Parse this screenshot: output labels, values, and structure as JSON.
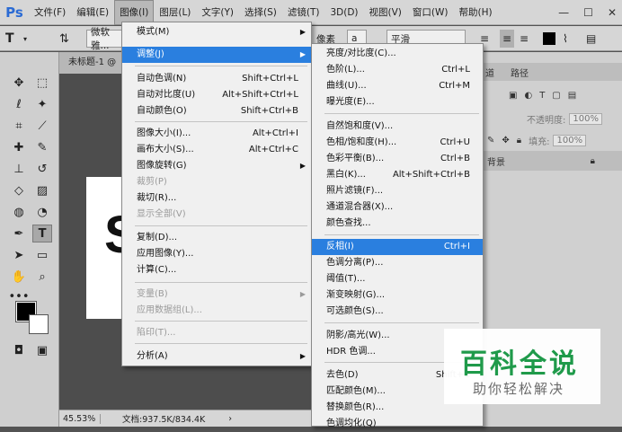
{
  "app": {
    "logo": "Ps",
    "menubar": [
      "文件(F)",
      "编辑(E)",
      "图像(I)",
      "图层(L)",
      "文字(Y)",
      "选择(S)",
      "滤镜(T)",
      "3D(D)",
      "视图(V)",
      "窗口(W)",
      "帮助(H)"
    ],
    "active_menu_index": 2,
    "window_controls": [
      "—",
      "☐",
      "✕"
    ]
  },
  "options_bar": {
    "font_name": "微软雅...",
    "font_style": "像素",
    "aa_label": "a",
    "aa_mode": "平滑"
  },
  "document": {
    "tab_title": "未标题-1 @",
    "zoom": "45.53%",
    "doc_info": "文档:937.5K/834.4K",
    "canvas_letter": "S"
  },
  "panels": {
    "tabs": [
      "道",
      "路径"
    ],
    "opacity_label": "不透明度:",
    "opacity_value": "100%",
    "fill_label": "填充:",
    "fill_value": "100%",
    "layer_name": "背景"
  },
  "image_menu": {
    "items": [
      {
        "label": "模式(M)",
        "shortcut": "",
        "arrow": true,
        "disabled": false
      },
      {
        "label": "调整(J)",
        "shortcut": "",
        "arrow": true,
        "disabled": false,
        "highlighted": true
      },
      {
        "label": "自动色调(N)",
        "shortcut": "Shift+Ctrl+L"
      },
      {
        "label": "自动对比度(U)",
        "shortcut": "Alt+Shift+Ctrl+L"
      },
      {
        "label": "自动颜色(O)",
        "shortcut": "Shift+Ctrl+B"
      },
      {
        "label": "图像大小(I)...",
        "shortcut": "Alt+Ctrl+I"
      },
      {
        "label": "画布大小(S)...",
        "shortcut": "Alt+Ctrl+C"
      },
      {
        "label": "图像旋转(G)",
        "shortcut": "",
        "arrow": true
      },
      {
        "label": "裁剪(P)",
        "shortcut": "",
        "disabled": true
      },
      {
        "label": "裁切(R)...",
        "shortcut": ""
      },
      {
        "label": "显示全部(V)",
        "shortcut": "",
        "disabled": true
      },
      {
        "label": "复制(D)...",
        "shortcut": ""
      },
      {
        "label": "应用图像(Y)...",
        "shortcut": ""
      },
      {
        "label": "计算(C)...",
        "shortcut": ""
      },
      {
        "label": "变量(B)",
        "shortcut": "",
        "arrow": true,
        "disabled": true
      },
      {
        "label": "应用数据组(L)...",
        "shortcut": "",
        "disabled": true
      },
      {
        "label": "陷印(T)...",
        "shortcut": "",
        "disabled": true
      },
      {
        "label": "分析(A)",
        "shortcut": "",
        "arrow": true
      }
    ]
  },
  "adjust_menu": {
    "items": [
      {
        "label": "亮度/对比度(C)...",
        "shortcut": ""
      },
      {
        "label": "色阶(L)...",
        "shortcut": "Ctrl+L"
      },
      {
        "label": "曲线(U)...",
        "shortcut": "Ctrl+M"
      },
      {
        "label": "曝光度(E)...",
        "shortcut": ""
      },
      {
        "label": "自然饱和度(V)...",
        "shortcut": ""
      },
      {
        "label": "色相/饱和度(H)...",
        "shortcut": "Ctrl+U"
      },
      {
        "label": "色彩平衡(B)...",
        "shortcut": "Ctrl+B"
      },
      {
        "label": "黑白(K)...",
        "shortcut": "Alt+Shift+Ctrl+B"
      },
      {
        "label": "照片滤镜(F)...",
        "shortcut": ""
      },
      {
        "label": "通道混合器(X)...",
        "shortcut": ""
      },
      {
        "label": "颜色查找...",
        "shortcut": ""
      },
      {
        "label": "反相(I)",
        "shortcut": "Ctrl+I",
        "highlighted": true
      },
      {
        "label": "色调分离(P)...",
        "shortcut": ""
      },
      {
        "label": "阈值(T)...",
        "shortcut": ""
      },
      {
        "label": "渐变映射(G)...",
        "shortcut": ""
      },
      {
        "label": "可选颜色(S)...",
        "shortcut": ""
      },
      {
        "label": "阴影/高光(W)...",
        "shortcut": ""
      },
      {
        "label": "HDR 色调...",
        "shortcut": ""
      },
      {
        "label": "去色(D)",
        "shortcut": "Shift+C"
      },
      {
        "label": "匹配颜色(M)...",
        "shortcut": ""
      },
      {
        "label": "替换颜色(R)...",
        "shortcut": ""
      },
      {
        "label": "色调均化(Q)",
        "shortcut": ""
      }
    ]
  },
  "watermark": {
    "title": "百科全说",
    "subtitle": "助你轻松解决"
  },
  "colors": {
    "highlight": "#2a7fdf",
    "watermark_green": "#1f9a4a"
  }
}
